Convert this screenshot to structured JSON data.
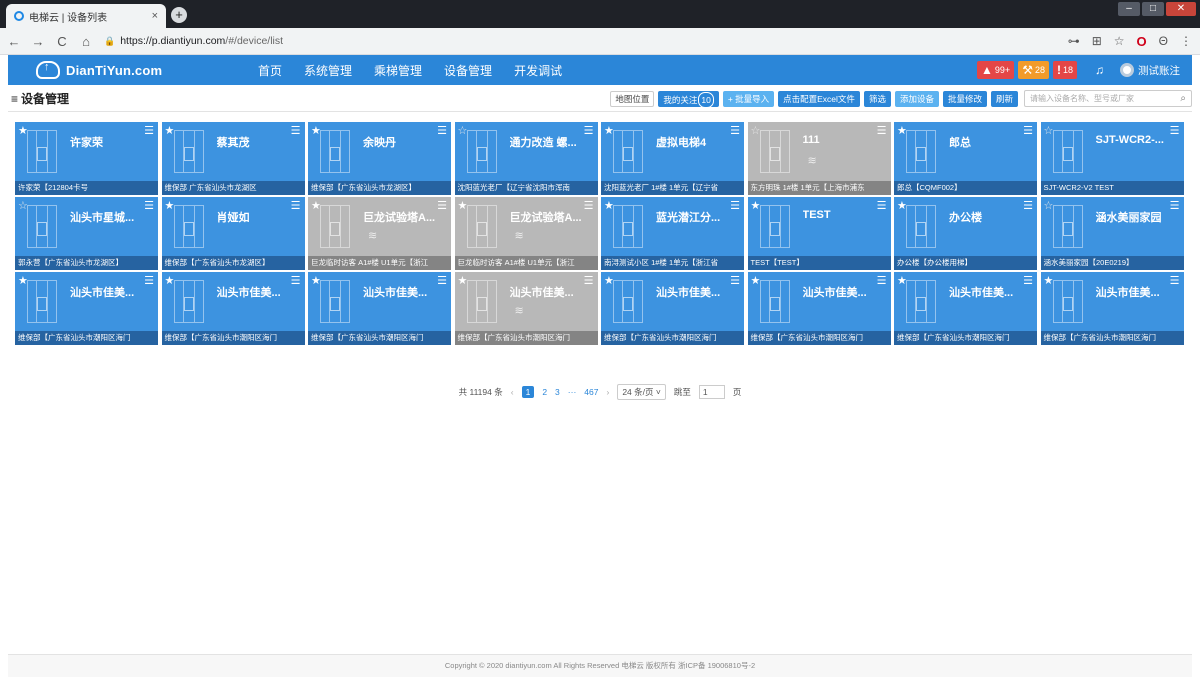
{
  "browser": {
    "tab_title": "电梯云 | 设备列表",
    "tab_close": "×",
    "new_tab": "+",
    "url_host": "https://p.diantiyun.com",
    "url_path": "/#/device/list"
  },
  "header": {
    "logo": "DianTiYun.com",
    "nav": [
      "首页",
      "系统管理",
      "乘梯管理",
      "设备管理",
      "开发调试"
    ],
    "alerts": [
      {
        "icon": "warning-icon",
        "count": "99+",
        "color": "#e44646"
      },
      {
        "icon": "wrench-icon",
        "count": "28",
        "color": "#f29b2a"
      },
      {
        "icon": "fault-icon",
        "count": "18",
        "color": "#e44646"
      }
    ],
    "user": "测试账注"
  },
  "page": {
    "title": "设备管理",
    "tools": {
      "map": "地图位置",
      "follow": "我的关注",
      "follow_count": "10",
      "batch_import": "+ 批量导入",
      "excel": "点击配置Excel文件",
      "filter": "筛选",
      "add": "添加设备",
      "batch_edit": "批量修改",
      "refresh": "刷新"
    },
    "search_placeholder": "请输入设备名称、型号或厂家"
  },
  "cards": [
    {
      "name": "许家荣",
      "foot": "许家荣【212804卡号",
      "online": true,
      "fav": true
    },
    {
      "name": "蔡其茂",
      "foot": "维保部 广东省汕头市龙湖区",
      "online": true,
      "fav": true
    },
    {
      "name": "余映丹",
      "foot": "维保部【广东省汕头市龙湖区】",
      "online": true,
      "fav": true
    },
    {
      "name": "通力改造 螺...",
      "foot": "沈阳蓝光老厂【辽宁省沈阳市浑南",
      "online": true,
      "fav": false
    },
    {
      "name": "虚拟电梯4",
      "foot": "沈阳蓝光老厂 1#楼 1单元【辽宁省",
      "online": true,
      "fav": true
    },
    {
      "name": "111",
      "foot": "东方明珠 1#楼 1单元【上海市浦东",
      "online": false,
      "fav": false
    },
    {
      "name": "郎总",
      "foot": "郎总【CQMF002】",
      "online": true,
      "fav": true
    },
    {
      "name": "SJT-WCR2-...",
      "foot": "SJT-WCR2-V2 TEST",
      "online": true,
      "fav": false
    },
    {
      "name": "汕头市星城...",
      "foot": "郭永营【广东省汕头市龙湖区】",
      "online": true,
      "fav": false
    },
    {
      "name": "肖娅如",
      "foot": "维保部【广东省汕头市龙湖区】",
      "online": true,
      "fav": true
    },
    {
      "name": "巨龙试验塔A...",
      "foot": "巨龙临时访客 A1#楼 U1单元【浙江",
      "online": false,
      "fav": true
    },
    {
      "name": "巨龙试验塔A...",
      "foot": "巨龙临时访客 A1#楼 U1单元【浙江",
      "online": false,
      "fav": true
    },
    {
      "name": "蓝光潜江分...",
      "foot": "南浔测试小区 1#楼 1单元【浙江省",
      "online": true,
      "fav": true
    },
    {
      "name": "TEST",
      "foot": "TEST【TEST】",
      "online": true,
      "fav": true
    },
    {
      "name": "办公楼",
      "foot": "办公楼【办公楼用梯】",
      "online": true,
      "fav": true
    },
    {
      "name": "涵水美丽家园",
      "foot": "涵水美丽家园【20E0219】",
      "online": true,
      "fav": false
    },
    {
      "name": "汕头市佳美...",
      "foot": "维保部【广东省汕头市潮阳区海门",
      "online": true,
      "fav": true
    },
    {
      "name": "汕头市佳美...",
      "foot": "维保部【广东省汕头市潮阳区海门",
      "online": true,
      "fav": true
    },
    {
      "name": "汕头市佳美...",
      "foot": "维保部【广东省汕头市潮阳区海门",
      "online": true,
      "fav": true
    },
    {
      "name": "汕头市佳美...",
      "foot": "维保部【广东省汕头市潮阳区海门",
      "online": false,
      "fav": true
    },
    {
      "name": "汕头市佳美...",
      "foot": "维保部【广东省汕头市潮阳区海门",
      "online": true,
      "fav": true
    },
    {
      "name": "汕头市佳美...",
      "foot": "维保部【广东省汕头市潮阳区海门",
      "online": true,
      "fav": true
    },
    {
      "name": "汕头市佳美...",
      "foot": "维保部【广东省汕头市潮阳区海门",
      "online": true,
      "fav": true
    },
    {
      "name": "汕头市佳美...",
      "foot": "维保部【广东省汕头市潮阳区海门",
      "online": true,
      "fav": true
    }
  ],
  "pagination": {
    "total": "共 11194 条",
    "pages": [
      "1",
      "2",
      "3",
      "···",
      "467"
    ],
    "current": "1",
    "per_page": "24 条/页",
    "goto_label": "跳至",
    "goto_value": "1",
    "page_suffix": "页"
  },
  "footer": "Copyright © 2020 diantiyun.com All Rights Reserved 电梯云 版权所有 浙ICP备 19006810号-2"
}
